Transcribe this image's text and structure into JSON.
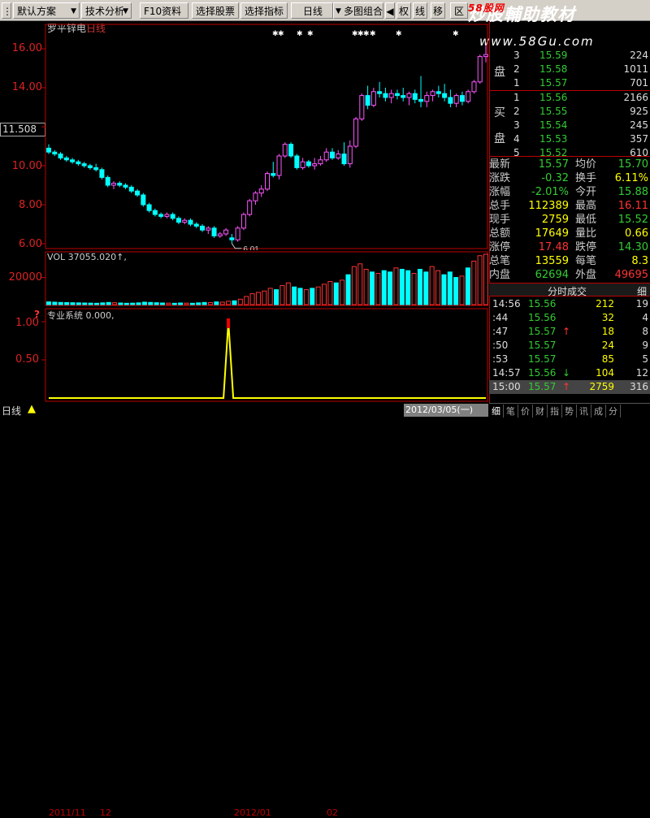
{
  "toolbar": {
    "default_scheme": "默认方案",
    "tech_analysis": "技术分析",
    "f10": "F10资料",
    "select_stock": "选择股票",
    "select_indicator": "选择指标",
    "daily": "日线",
    "multi_chart": "多图组合",
    "right_tabs": [
      "权",
      "线",
      "移",
      "区"
    ]
  },
  "watermark": {
    "text1": "炒股輔助教材",
    "text2": "58股网",
    "url": "www.58Gu.com"
  },
  "chart": {
    "stock_name": "罗平锌电",
    "period": "日线",
    "price_ticks": [
      "16.00",
      "14.00",
      "10.00",
      "8.00",
      "6.00"
    ],
    "current_price_box": "11.508",
    "low_marker": "6.01",
    "vol_label": "VOL 37055.020↑,",
    "vol_tick": "20000",
    "ind_label": "专业系统 0.000,",
    "ind_ticks": [
      "1.00",
      "0.50"
    ],
    "ind_question": "?"
  },
  "chart_data": [
    {
      "type": "candlestick",
      "title": "罗平锌电 日线",
      "ylim": [
        6,
        16
      ],
      "candles": [
        {
          "o": 10.9,
          "h": 11.1,
          "l": 10.6,
          "c": 10.7
        },
        {
          "o": 10.7,
          "h": 10.8,
          "l": 10.5,
          "c": 10.6
        },
        {
          "o": 10.6,
          "h": 10.7,
          "l": 10.3,
          "c": 10.4
        },
        {
          "o": 10.4,
          "h": 10.5,
          "l": 10.2,
          "c": 10.3
        },
        {
          "o": 10.3,
          "h": 10.4,
          "l": 10.1,
          "c": 10.2
        },
        {
          "o": 10.2,
          "h": 10.3,
          "l": 10.0,
          "c": 10.1
        },
        {
          "o": 10.1,
          "h": 10.2,
          "l": 9.9,
          "c": 10.0
        },
        {
          "o": 10.0,
          "h": 10.1,
          "l": 9.8,
          "c": 9.9
        },
        {
          "o": 9.9,
          "h": 10.1,
          "l": 9.7,
          "c": 9.8
        },
        {
          "o": 9.8,
          "h": 9.9,
          "l": 9.3,
          "c": 9.4
        },
        {
          "o": 9.4,
          "h": 9.5,
          "l": 8.9,
          "c": 9.0
        },
        {
          "o": 9.0,
          "h": 9.2,
          "l": 8.8,
          "c": 9.1
        },
        {
          "o": 9.1,
          "h": 9.2,
          "l": 8.9,
          "c": 9.0
        },
        {
          "o": 9.0,
          "h": 9.1,
          "l": 8.8,
          "c": 8.9
        },
        {
          "o": 8.9,
          "h": 9.0,
          "l": 8.6,
          "c": 8.7
        },
        {
          "o": 8.7,
          "h": 8.8,
          "l": 8.4,
          "c": 8.5
        },
        {
          "o": 8.5,
          "h": 8.6,
          "l": 7.9,
          "c": 8.0
        },
        {
          "o": 8.0,
          "h": 8.1,
          "l": 7.6,
          "c": 7.7
        },
        {
          "o": 7.7,
          "h": 7.8,
          "l": 7.4,
          "c": 7.5
        },
        {
          "o": 7.5,
          "h": 7.6,
          "l": 7.3,
          "c": 7.4
        },
        {
          "o": 7.4,
          "h": 7.6,
          "l": 7.3,
          "c": 7.5
        },
        {
          "o": 7.5,
          "h": 7.6,
          "l": 7.2,
          "c": 7.3
        },
        {
          "o": 7.3,
          "h": 7.4,
          "l": 7.0,
          "c": 7.1
        },
        {
          "o": 7.1,
          "h": 7.3,
          "l": 7.0,
          "c": 7.2
        },
        {
          "o": 7.2,
          "h": 7.3,
          "l": 6.9,
          "c": 7.0
        },
        {
          "o": 7.0,
          "h": 7.1,
          "l": 6.8,
          "c": 6.9
        },
        {
          "o": 6.9,
          "h": 7.0,
          "l": 6.6,
          "c": 6.7
        },
        {
          "o": 6.7,
          "h": 6.9,
          "l": 6.5,
          "c": 6.8
        },
        {
          "o": 6.8,
          "h": 6.9,
          "l": 6.3,
          "c": 6.4
        },
        {
          "o": 6.4,
          "h": 6.6,
          "l": 6.3,
          "c": 6.5
        },
        {
          "o": 6.5,
          "h": 6.8,
          "l": 6.4,
          "c": 6.7
        },
        {
          "o": 6.3,
          "h": 6.5,
          "l": 6.01,
          "c": 6.2
        },
        {
          "o": 6.2,
          "h": 6.9,
          "l": 6.1,
          "c": 6.8
        },
        {
          "o": 6.8,
          "h": 7.6,
          "l": 6.7,
          "c": 7.5
        },
        {
          "o": 7.5,
          "h": 8.3,
          "l": 7.4,
          "c": 8.2
        },
        {
          "o": 8.2,
          "h": 8.7,
          "l": 8.0,
          "c": 8.6
        },
        {
          "o": 8.6,
          "h": 9.0,
          "l": 8.4,
          "c": 8.8
        },
        {
          "o": 8.8,
          "h": 9.7,
          "l": 8.7,
          "c": 9.6
        },
        {
          "o": 9.6,
          "h": 10.2,
          "l": 9.4,
          "c": 9.5
        },
        {
          "o": 9.5,
          "h": 10.6,
          "l": 9.3,
          "c": 10.5
        },
        {
          "o": 10.5,
          "h": 11.2,
          "l": 10.4,
          "c": 11.1
        },
        {
          "o": 11.1,
          "h": 11.2,
          "l": 10.4,
          "c": 10.5
        },
        {
          "o": 10.5,
          "h": 10.6,
          "l": 9.8,
          "c": 9.9
        },
        {
          "o": 9.9,
          "h": 10.4,
          "l": 9.8,
          "c": 10.2
        },
        {
          "o": 10.2,
          "h": 10.3,
          "l": 9.9,
          "c": 10.0
        },
        {
          "o": 10.0,
          "h": 10.4,
          "l": 9.8,
          "c": 10.1
        },
        {
          "o": 10.1,
          "h": 10.5,
          "l": 10.0,
          "c": 10.3
        },
        {
          "o": 10.3,
          "h": 10.9,
          "l": 10.2,
          "c": 10.7
        },
        {
          "o": 10.7,
          "h": 10.9,
          "l": 10.3,
          "c": 10.4
        },
        {
          "o": 10.4,
          "h": 10.8,
          "l": 10.3,
          "c": 10.6
        },
        {
          "o": 10.6,
          "h": 11.2,
          "l": 10.0,
          "c": 10.1
        },
        {
          "o": 10.1,
          "h": 11.3,
          "l": 9.9,
          "c": 11.0
        },
        {
          "o": 11.0,
          "h": 12.5,
          "l": 10.9,
          "c": 12.4
        },
        {
          "o": 12.4,
          "h": 13.7,
          "l": 12.3,
          "c": 13.6
        },
        {
          "o": 13.6,
          "h": 14.1,
          "l": 12.9,
          "c": 13.1
        },
        {
          "o": 13.1,
          "h": 14.0,
          "l": 13.0,
          "c": 13.8
        },
        {
          "o": 13.8,
          "h": 14.3,
          "l": 13.5,
          "c": 13.7
        },
        {
          "o": 13.7,
          "h": 14.0,
          "l": 13.3,
          "c": 13.5
        },
        {
          "o": 13.5,
          "h": 13.9,
          "l": 13.2,
          "c": 13.7
        },
        {
          "o": 13.7,
          "h": 13.9,
          "l": 13.4,
          "c": 13.6
        },
        {
          "o": 13.6,
          "h": 14.0,
          "l": 13.3,
          "c": 13.5
        },
        {
          "o": 13.5,
          "h": 13.8,
          "l": 13.1,
          "c": 13.7
        },
        {
          "o": 13.7,
          "h": 13.9,
          "l": 13.2,
          "c": 13.4
        },
        {
          "o": 13.4,
          "h": 14.6,
          "l": 13.0,
          "c": 13.3
        },
        {
          "o": 13.3,
          "h": 13.8,
          "l": 13.0,
          "c": 13.6
        },
        {
          "o": 13.6,
          "h": 13.9,
          "l": 13.3,
          "c": 13.8
        },
        {
          "o": 13.8,
          "h": 14.1,
          "l": 13.5,
          "c": 13.7
        },
        {
          "o": 13.7,
          "h": 14.2,
          "l": 13.3,
          "c": 13.5
        },
        {
          "o": 13.5,
          "h": 13.9,
          "l": 13.0,
          "c": 13.2
        },
        {
          "o": 13.2,
          "h": 13.7,
          "l": 13.0,
          "c": 13.6
        },
        {
          "o": 13.6,
          "h": 13.8,
          "l": 13.1,
          "c": 13.3
        },
        {
          "o": 13.3,
          "h": 13.9,
          "l": 13.2,
          "c": 13.8
        },
        {
          "o": 13.8,
          "h": 14.4,
          "l": 13.7,
          "c": 14.3
        },
        {
          "o": 14.3,
          "h": 15.7,
          "l": 14.2,
          "c": 15.6
        },
        {
          "o": 15.6,
          "h": 16.2,
          "l": 15.3,
          "c": 15.7
        }
      ]
    },
    {
      "type": "bar",
      "title": "VOL",
      "ylim": [
        0,
        37055
      ],
      "values": [
        2000,
        1800,
        1600,
        1500,
        1400,
        1300,
        1200,
        1100,
        1000,
        1300,
        1600,
        1400,
        1200,
        1000,
        1100,
        1300,
        1800,
        1600,
        1400,
        1200,
        1100,
        1000,
        1200,
        1100,
        1000,
        1300,
        1600,
        1500,
        2000,
        1800,
        2500,
        2800,
        4000,
        6000,
        8000,
        9000,
        10000,
        12000,
        11000,
        14000,
        16000,
        13000,
        12000,
        11000,
        12000,
        13000,
        15000,
        17000,
        16000,
        18000,
        22000,
        28000,
        30000,
        26000,
        24000,
        23000,
        25000,
        24000,
        27000,
        26000,
        25000,
        23000,
        26000,
        24000,
        28000,
        25000,
        22000,
        24000,
        20000,
        21000,
        27000,
        32000,
        36000,
        37055
      ]
    },
    {
      "type": "line",
      "title": "专业系统",
      "ylim": [
        0,
        1.2
      ],
      "values": [
        0,
        0,
        0,
        0,
        0,
        0,
        0,
        0,
        0,
        0,
        0,
        0,
        0,
        0,
        0,
        0,
        0,
        0,
        0,
        0,
        0,
        0,
        0,
        0,
        0,
        0,
        0,
        0,
        0,
        0,
        0,
        0,
        0,
        0,
        0,
        0,
        0,
        0,
        0,
        0,
        0,
        0,
        0,
        0,
        0,
        0,
        0,
        0,
        0,
        0,
        0,
        0,
        0,
        0,
        0,
        0,
        0,
        0,
        0,
        0,
        0,
        0,
        0,
        0,
        0,
        0,
        0,
        0,
        0,
        0,
        0,
        0,
        0,
        0
      ],
      "spike_index": 30,
      "spike_value": 1.0
    }
  ],
  "orderbook": {
    "sell_label": "盘",
    "buy_label_1": "买",
    "buy_label_2": "盘",
    "sell": [
      {
        "n": "3",
        "price": "15.59",
        "vol": "224"
      },
      {
        "n": "2",
        "price": "15.58",
        "vol": "1011"
      },
      {
        "n": "1",
        "price": "15.57",
        "vol": "701"
      }
    ],
    "buy": [
      {
        "n": "1",
        "price": "15.56",
        "vol": "2166"
      },
      {
        "n": "2",
        "price": "15.55",
        "vol": "925"
      },
      {
        "n": "3",
        "price": "15.54",
        "vol": "245"
      },
      {
        "n": "4",
        "price": "15.53",
        "vol": "357"
      },
      {
        "n": "5",
        "price": "15.52",
        "vol": "610"
      }
    ]
  },
  "quote": [
    {
      "l1": "最新",
      "v1": "15.57",
      "c1": "grn",
      "l2": "均价",
      "v2": "15.70",
      "c2": "grn"
    },
    {
      "l1": "涨跌",
      "v1": "-0.32",
      "c1": "grn",
      "l2": "换手",
      "v2": "6.11%",
      "c2": "yel"
    },
    {
      "l1": "涨幅",
      "v1": "-2.01%",
      "c1": "grn",
      "l2": "今开",
      "v2": "15.88",
      "c2": "grn"
    },
    {
      "l1": "总手",
      "v1": "112389",
      "c1": "yel",
      "l2": "最高",
      "v2": "16.11",
      "c2": "red"
    },
    {
      "l1": "现手",
      "v1": "2759",
      "c1": "yel",
      "l2": "最低",
      "v2": "15.52",
      "c2": "grn"
    },
    {
      "l1": "总额",
      "v1": "17649",
      "c1": "yel",
      "l2": "量比",
      "v2": "0.66",
      "c2": "yel"
    },
    {
      "l1": "涨停",
      "v1": "17.48",
      "c1": "red",
      "l2": "跌停",
      "v2": "14.30",
      "c2": "grn"
    },
    {
      "l1": "总笔",
      "v1": "13559",
      "c1": "yel",
      "l2": "每笔",
      "v2": "8.3",
      "c2": "yel"
    },
    {
      "l1": "内盘",
      "v1": "62694",
      "c1": "grn",
      "l2": "外盘",
      "v2": "49695",
      "c2": "red"
    }
  ],
  "ticks_header": {
    "title": "分时成交",
    "tab": "细"
  },
  "ticks": [
    {
      "t": "14:56",
      "p": "15.56",
      "pc": "grn",
      "arrow": "",
      "v": "212",
      "n": "19"
    },
    {
      "t": ":44",
      "p": "15.56",
      "pc": "grn",
      "arrow": "",
      "v": "32",
      "n": "4"
    },
    {
      "t": ":47",
      "p": "15.57",
      "pc": "grn",
      "arrow": "↑",
      "v": "18",
      "n": "8"
    },
    {
      "t": ":50",
      "p": "15.57",
      "pc": "grn",
      "arrow": "",
      "v": "24",
      "n": "9"
    },
    {
      "t": ":53",
      "p": "15.57",
      "pc": "grn",
      "arrow": "",
      "v": "85",
      "n": "5"
    },
    {
      "t": "14:57",
      "p": "15.56",
      "pc": "grn",
      "arrow": "↓",
      "v": "104",
      "n": "12"
    },
    {
      "t": "15:00",
      "p": "15.57",
      "pc": "grn",
      "arrow": "↑",
      "v": "2759",
      "n": "316"
    }
  ],
  "bottom": {
    "period": "日线",
    "dates": [
      "2011/11",
      "12",
      "2012/01",
      "02"
    ],
    "current_date": "2012/03/05(一)",
    "side_tabs": [
      "细",
      "笔",
      "价",
      "财",
      "指",
      "势",
      "讯",
      "成",
      "分"
    ]
  },
  "colors": {
    "up": "#ff55ff",
    "down": "#00ffff",
    "vol_up": "#ff3333",
    "bg": "#000000",
    "grid": "#880000"
  }
}
